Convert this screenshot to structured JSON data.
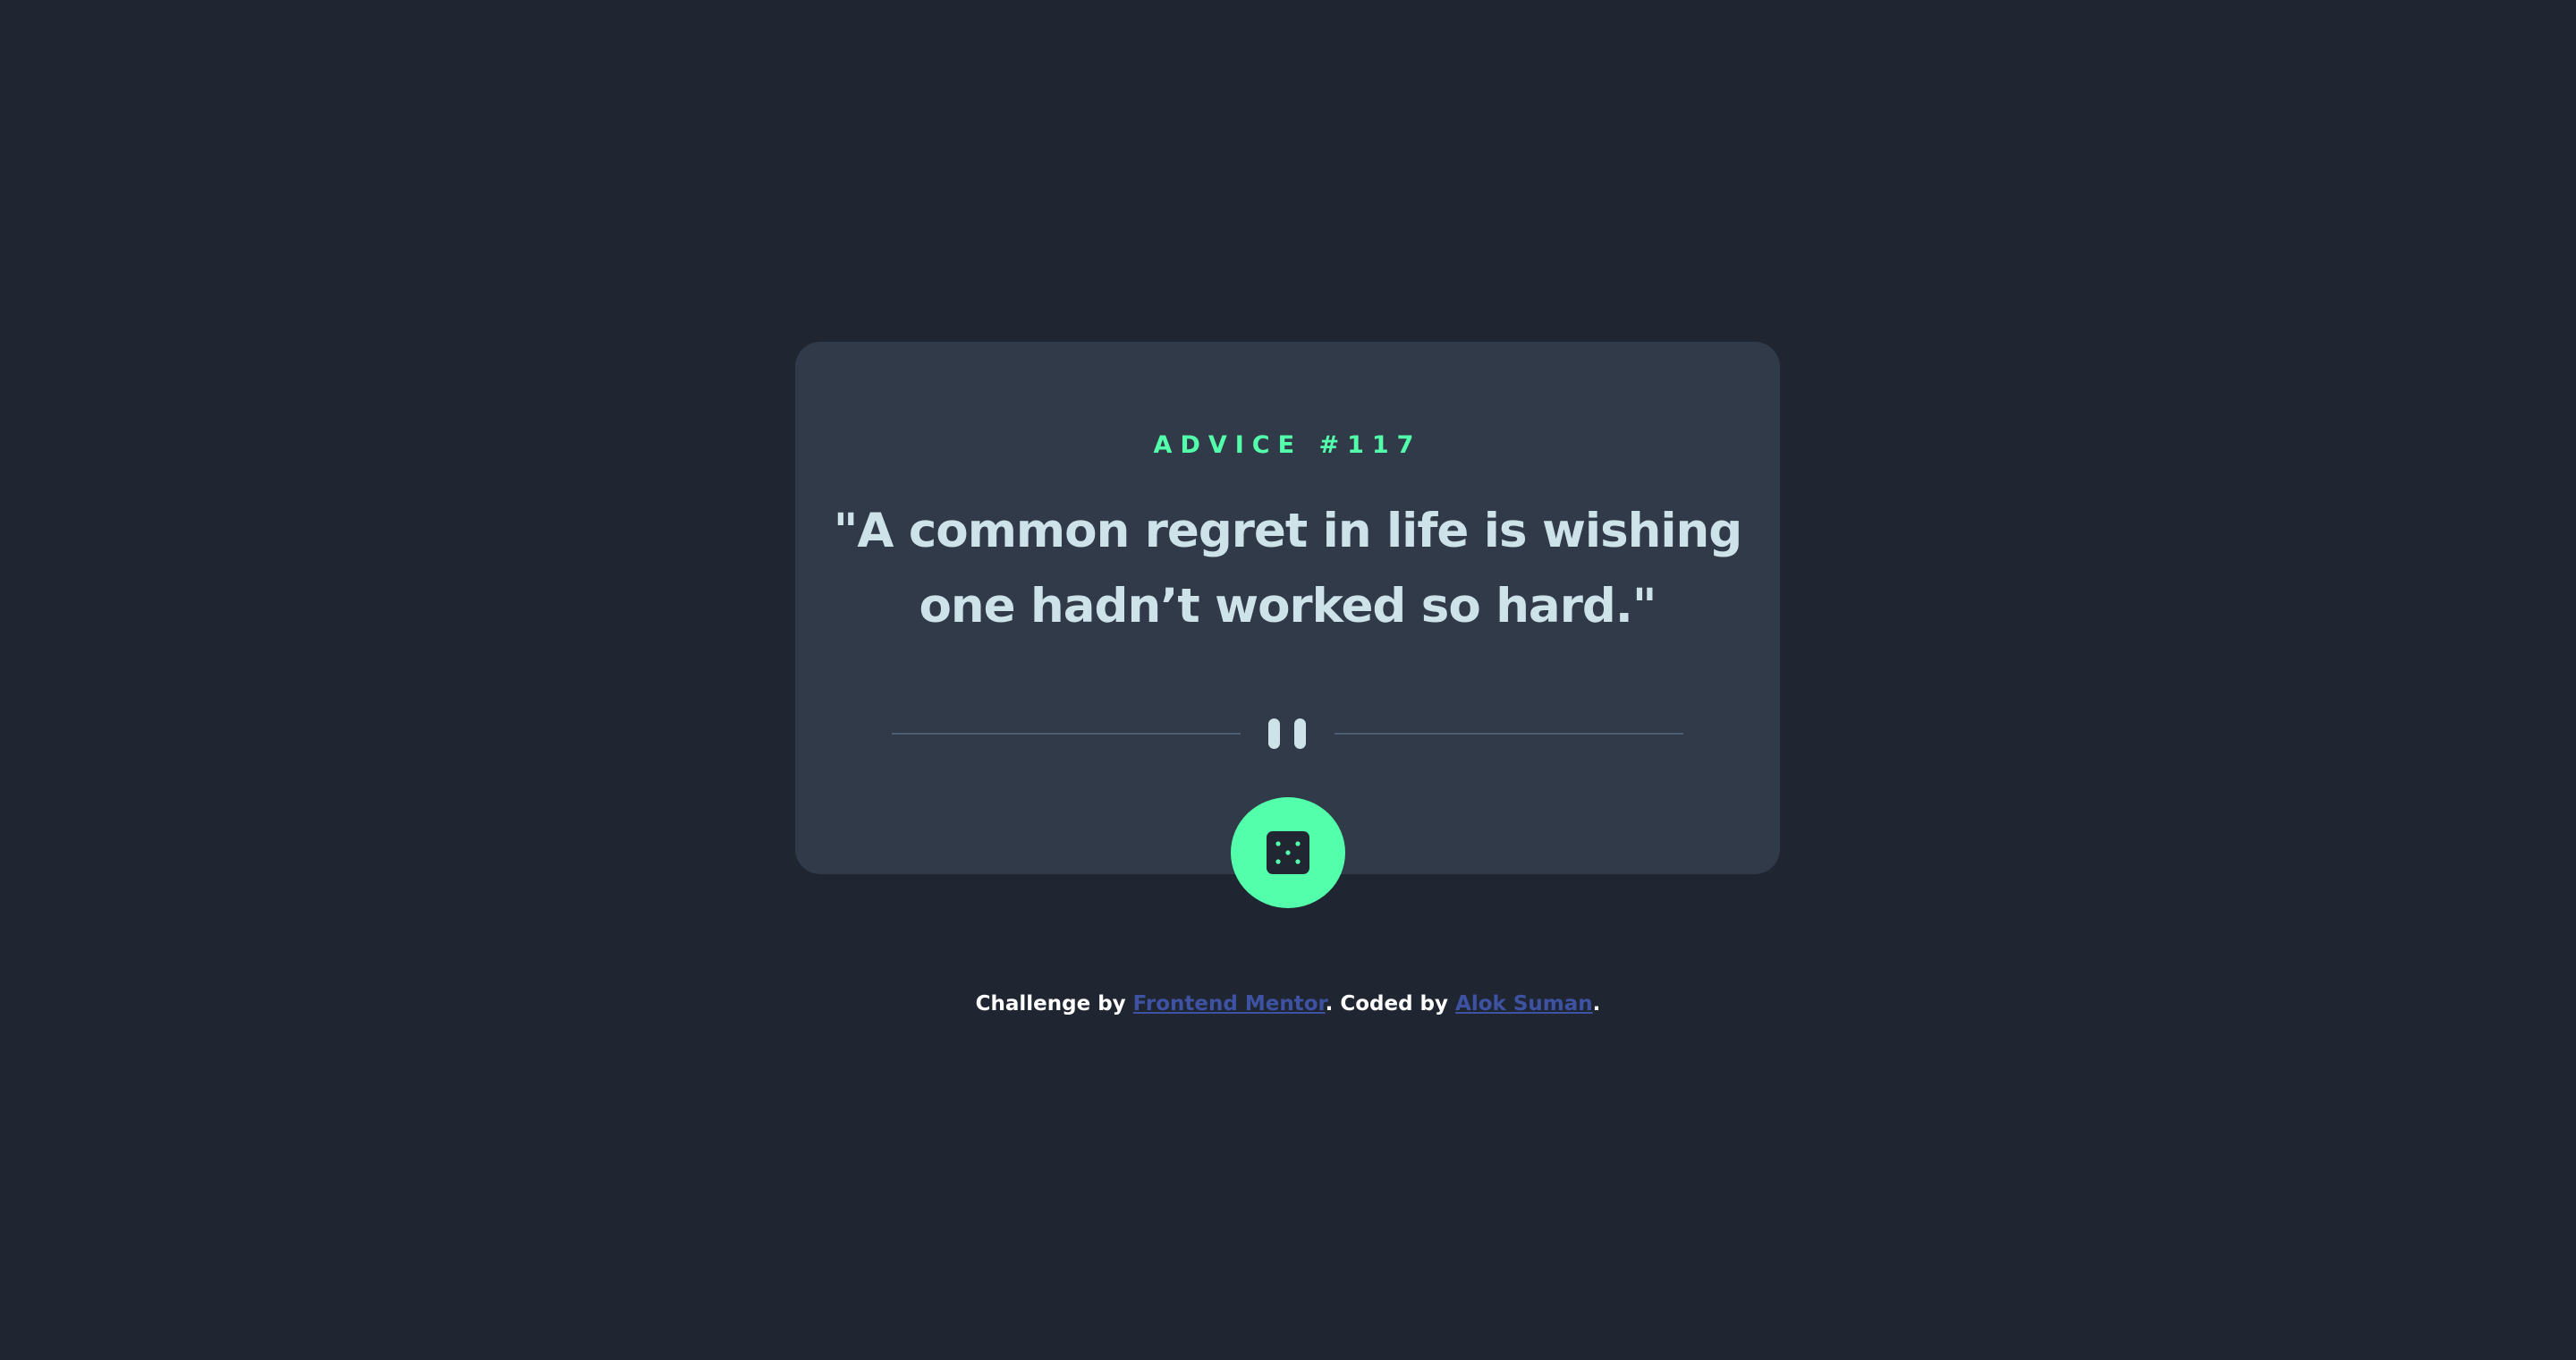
{
  "card": {
    "advice_label": "ADVICE #117",
    "quote": "\"A common regret in life is wishing one hadn’t worked so hard.\"",
    "divider_icon": "pause-icon",
    "dice_button_icon": "dice-icon"
  },
  "footer": {
    "prefix": "Challenge by ",
    "challenge_link": "Frontend Mentor",
    "middle": ". Coded by ",
    "author_link": "Alok Suman",
    "suffix": "."
  },
  "colors": {
    "background": "#1f2631",
    "card": "#313a49",
    "accent": "#53ffaa",
    "quote_text": "#cee3e9",
    "link": "#3e52a3",
    "divider": "#4f5d74"
  }
}
